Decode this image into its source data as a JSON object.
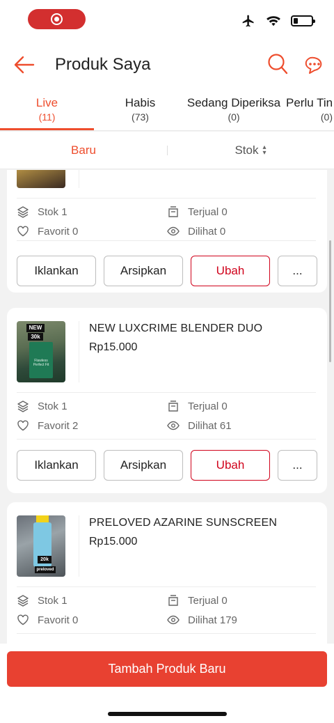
{
  "header": {
    "title": "Produk Saya"
  },
  "tabs": [
    {
      "label": "Live",
      "count": "(11)"
    },
    {
      "label": "Habis",
      "count": "(73)"
    },
    {
      "label": "Sedang Diperiksa",
      "count": "(0)"
    },
    {
      "label": "Perlu Tin",
      "count": "(0)"
    }
  ],
  "sort": {
    "newest": "Baru",
    "stock": "Stok"
  },
  "stat_labels": {
    "stock": "Stok",
    "sold": "Terjual",
    "favorite": "Favorit",
    "views": "Dilihat"
  },
  "actions": {
    "advertise": "Iklankan",
    "archive": "Arsipkan",
    "edit": "Ubah",
    "more": "..."
  },
  "products": [
    {
      "name": "",
      "price": "",
      "stock": "1",
      "sold": "0",
      "favorite": "0",
      "views": "0"
    },
    {
      "name": "NEW LUXCRIME BLENDER DUO",
      "price": "Rp15.000",
      "stock": "1",
      "sold": "0",
      "favorite": "2",
      "views": "61",
      "badges": [
        "NEW",
        "30k"
      ],
      "thumb_text": [
        "Flawless",
        "Perfect Fit"
      ]
    },
    {
      "name": "PRELOVED AZARINE SUNSCREEN",
      "price": "Rp15.000",
      "stock": "1",
      "sold": "0",
      "favorite": "0",
      "views": "179",
      "badges": [
        "20k",
        "preloved"
      ]
    }
  ],
  "footer": {
    "add_label": "Tambah Produk Baru"
  },
  "colors": {
    "accent": "#ee4d2d",
    "button_red": "#e84131",
    "edit_border": "#d0021b"
  },
  "icons": [
    "back-arrow-icon",
    "search-icon",
    "chat-icon",
    "layers-icon",
    "heart-icon",
    "box-icon",
    "eye-icon",
    "airplane-icon",
    "wifi-icon",
    "battery-icon"
  ]
}
